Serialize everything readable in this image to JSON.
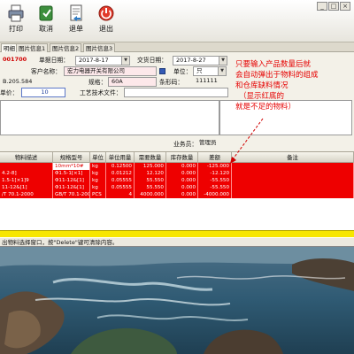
{
  "toolbar": {
    "buttons": [
      {
        "label": "打印",
        "icon": "printer-icon"
      },
      {
        "label": "取消",
        "icon": "cancel-icon"
      },
      {
        "label": "退单",
        "icon": "return-icon"
      },
      {
        "label": "退出",
        "icon": "exit-icon"
      }
    ]
  },
  "window_buttons": {
    "minimize": "_",
    "maximize": "□",
    "close": "×"
  },
  "tabs": [
    {
      "label": "明细"
    },
    {
      "label": "图片信息1"
    },
    {
      "label": "图片信息2"
    },
    {
      "label": "图片信息3"
    }
  ],
  "form": {
    "order_no": "0017001",
    "order_date_label": "单据日期：",
    "order_date": "2017-8-17",
    "delivery_date_label": "交货日期：",
    "delivery_date": "2017-8-27",
    "customer_label": "客户名称：",
    "customer_value": "宏力电器开关有限公司",
    "unit_label": "单位：",
    "unit_value": "只",
    "part_no_value": "B.205.584",
    "spec_label": "规格：",
    "spec_value": "60A",
    "barcode_label": "条形码：",
    "barcode_value": "111111",
    "qty_value": "10",
    "price_label": "单价：",
    "tech_file_label": "工艺技术文件：",
    "salesman_label": "业务员：",
    "salesman_value": "管理员"
  },
  "grid": {
    "headers": [
      "物料描述",
      "规格型号",
      "单位",
      "单位用量",
      "需要数量",
      "库存数量",
      "差额",
      "备注"
    ],
    "rows": [
      {
        "desc": "",
        "spec": "10mm*10#",
        "unit": "kg",
        "per": "0.12500",
        "need": "125.000",
        "stock": "0.000",
        "diff": "-125.000",
        "note": ""
      },
      {
        "desc": "4.2-8]",
        "spec": "Φ1.5-1[×1]",
        "unit": "kg",
        "per": "0.01212",
        "need": "12.120",
        "stock": "0.000",
        "diff": "-12.120",
        "note": ""
      },
      {
        "desc": "1.5-1[×1]9",
        "spec": "Φ11-12&[1]",
        "unit": "kg",
        "per": "0.05555",
        "need": "55.550",
        "stock": "0.000",
        "diff": "-55.550",
        "note": ""
      },
      {
        "desc": "11-12&[1]",
        "spec": "Φ11-12&[1]",
        "unit": "kg",
        "per": "0.05555",
        "need": "55.550",
        "stock": "0.000",
        "diff": "-55.550",
        "note": ""
      },
      {
        "desc": "/T 70.1-2000",
        "spec": "GB/T 70.1-2000",
        "unit": "PCS",
        "per": "4",
        "need": "4000.000",
        "stock": "0.000",
        "diff": "-4000.000",
        "note": ""
      }
    ]
  },
  "status_text": "出物料选择窗口，按\"Delete\"键可清除内容。",
  "annotation": {
    "lines": [
      "只要输入产品数量后就",
      "会自动弹出于物料的组成",
      "和仓库缺料情况",
      "（显示红底的",
      "就是不足的物料）"
    ]
  },
  "colors": {
    "shortage_row": "#ee0000",
    "annotation": "#e60000",
    "yellow_bar": "#f7e600"
  }
}
